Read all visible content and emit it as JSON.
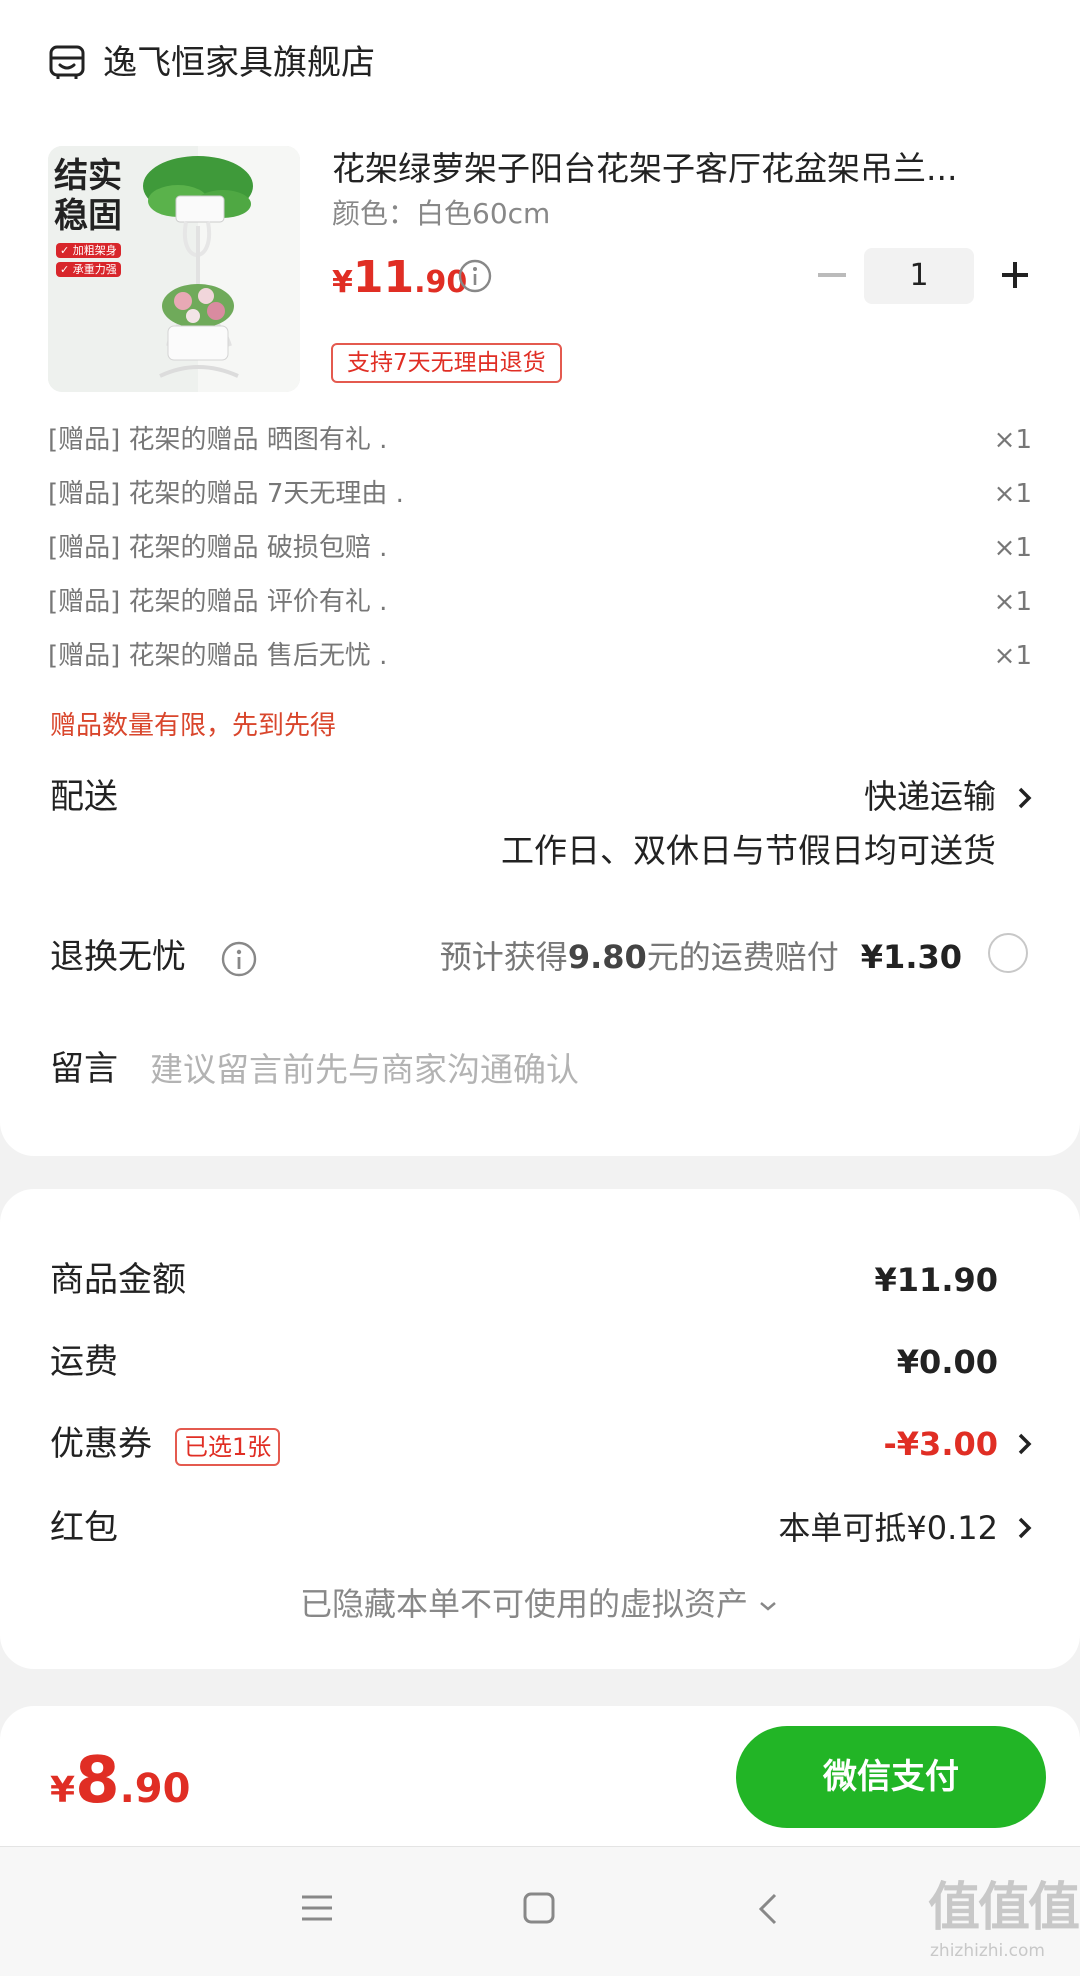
{
  "store": {
    "name": "逸飞恒家具旗舰店",
    "icon": "store-icon"
  },
  "product": {
    "title": "花架绿萝架子阳台花架子客厅花盆架吊兰...",
    "spec": "颜色：白色60cm",
    "price_currency": "¥",
    "price_int": "11",
    "price_dec": ".90",
    "quantity": "1",
    "return_tag": "支持7天无理由退货",
    "image_text": {
      "line1": "结实",
      "line2": "稳固",
      "badge1": "✓ 加粗架身",
      "badge2": "✓ 承重力强"
    }
  },
  "gifts": [
    {
      "label": "[赠品]  花架的赠品 晒图有礼 .",
      "qty": "×1"
    },
    {
      "label": "[赠品]  花架的赠品 7天无理由 .",
      "qty": "×1"
    },
    {
      "label": "[赠品]  花架的赠品 破损包赔 .",
      "qty": "×1"
    },
    {
      "label": "[赠品]  花架的赠品 评价有礼 .",
      "qty": "×1"
    },
    {
      "label": "[赠品]  花架的赠品 售后无忧 .",
      "qty": "×1"
    }
  ],
  "gift_note": "赠品数量有限，先到先得",
  "delivery": {
    "label": "配送",
    "method": "快递运输",
    "note": "工作日、双休日与节假日均可送货"
  },
  "return_worry": {
    "label": "退换无忧",
    "desc_prefix": "预计获得",
    "desc_amount": "9.80",
    "desc_suffix": "元的运费赔付",
    "price": "¥1.30"
  },
  "message": {
    "label": "留言",
    "placeholder": "建议留言前先与商家沟通确认"
  },
  "summary": {
    "goods_label": "商品金额",
    "goods_value": "¥11.90",
    "shipping_label": "运费",
    "shipping_value": "¥0.00",
    "coupon_label": "优惠券",
    "coupon_badge": "已选1张",
    "coupon_value": "-¥3.00",
    "redpacket_label": "红包",
    "redpacket_value": "本单可抵¥0.12",
    "hidden_assets": "已隐藏本单不可使用的虚拟资产"
  },
  "pay": {
    "currency": "¥",
    "total_int": "8",
    "total_dec": ".90",
    "button": "微信支付"
  },
  "watermark": {
    "main": "值值值",
    "sub": "zhizhizhi.com"
  },
  "colors": {
    "price_red": "#e02e24",
    "wechat_green": "#22b526"
  }
}
